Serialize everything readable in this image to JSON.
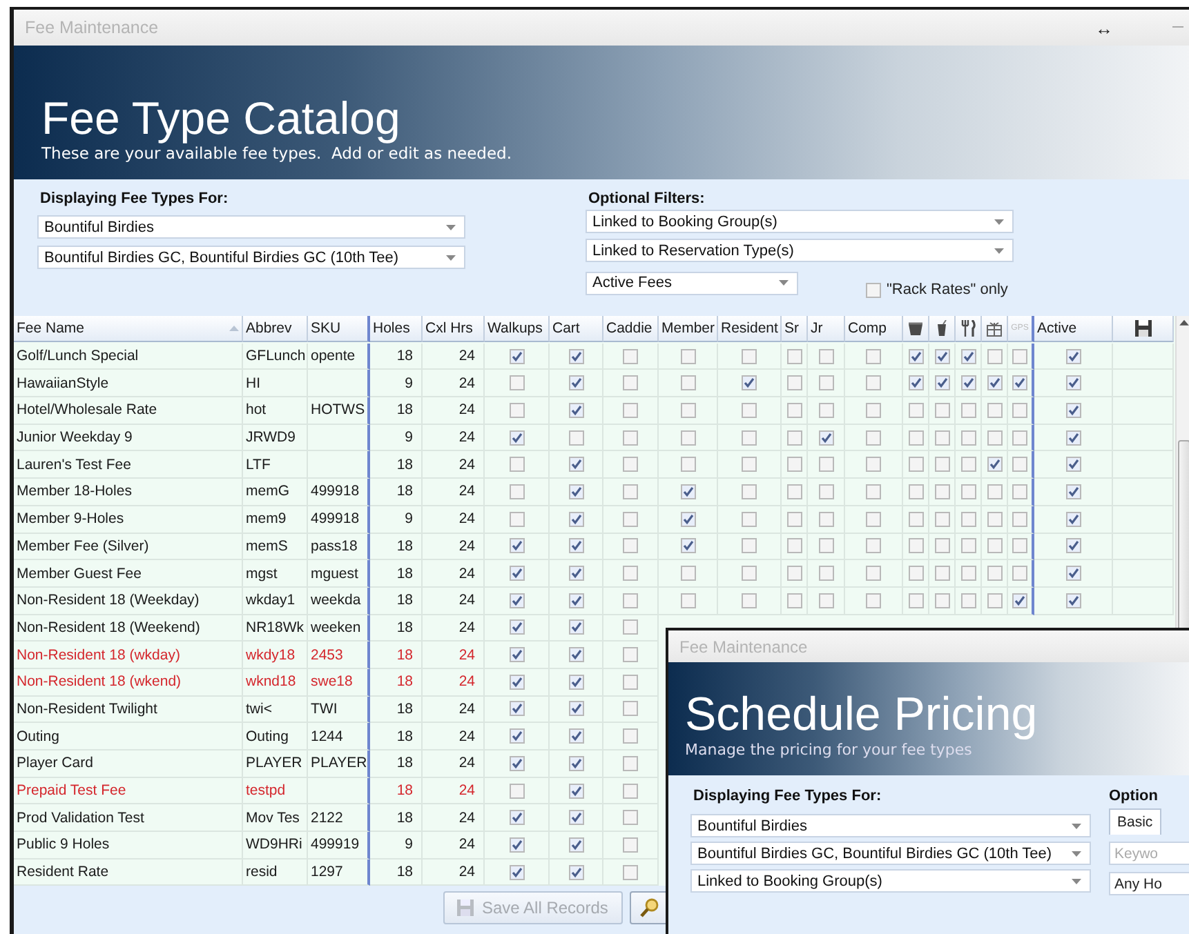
{
  "window": {
    "title": "Fee Maintenance",
    "resize_glyph": "↔"
  },
  "header": {
    "title": "Fee Type Catalog",
    "subtitle": "These are your available fee types.  Add or edit as needed."
  },
  "filters": {
    "label": "Displaying Fee Types For:",
    "dropdowns": [
      "Bountiful Birdies",
      "Bountiful Birdies GC, Bountiful Birdies GC (10th Tee)"
    ],
    "optional_label": "Optional Filters:",
    "optional_dropdowns": [
      "Linked to Booking Group(s)",
      "Linked to Reservation Type(s)",
      "Active Fees"
    ],
    "rack_rates": {
      "label": "\"Rack Rates\" only",
      "checked": false
    }
  },
  "table": {
    "columns": [
      {
        "label": "Fee Name",
        "sorted": true
      },
      {
        "label": "Abbrev",
        "sorted": false
      },
      {
        "label": "SKU",
        "sorted": false
      },
      {
        "label": "Holes",
        "sorted": false
      },
      {
        "label": "Cxl Hrs",
        "sorted": false
      }
    ],
    "check_columns": [
      {
        "kind": "text",
        "label": "Walkups"
      },
      {
        "kind": "text",
        "label": "Cart"
      },
      {
        "kind": "text",
        "label": "Caddie"
      },
      {
        "kind": "text",
        "label": "Member"
      },
      {
        "kind": "text",
        "label": "Resident"
      },
      {
        "kind": "text",
        "label": "Sr"
      },
      {
        "kind": "text",
        "label": "Jr"
      },
      {
        "kind": "text",
        "label": "Comp"
      },
      {
        "kind": "icon"
      },
      {
        "kind": "icon"
      },
      {
        "kind": "icon"
      },
      {
        "kind": "icon"
      },
      {
        "kind": "tag",
        "label": "GPS"
      },
      {
        "kind": "text",
        "label": "Active"
      }
    ],
    "rows": [
      {
        "name": "Golf/Lunch Special",
        "abbrev": "GFLunch",
        "sku": "opente",
        "holes": "18",
        "cxl_hrs": "24",
        "flagged": false,
        "checks": [
          true,
          true,
          false,
          false,
          false,
          false,
          false,
          false,
          true,
          true,
          true,
          false,
          false,
          true
        ]
      },
      {
        "name": "HawaiianStyle",
        "abbrev": "HI",
        "holes": "9",
        "cxl_hrs": "24",
        "flagged": false,
        "checks": [
          false,
          true,
          false,
          false,
          true,
          false,
          false,
          false,
          true,
          true,
          true,
          true,
          true,
          true
        ]
      },
      {
        "name": "Hotel/Wholesale Rate",
        "abbrev": "hot",
        "sku": "HOTWS",
        "holes": "18",
        "cxl_hrs": "24",
        "flagged": false,
        "checks": [
          false,
          true,
          false,
          false,
          false,
          false,
          false,
          false,
          false,
          false,
          false,
          false,
          false,
          true
        ]
      },
      {
        "name": "Junior Weekday 9",
        "abbrev": "JRWD9",
        "holes": "9",
        "cxl_hrs": "24",
        "flagged": false,
        "checks": [
          true,
          false,
          false,
          false,
          false,
          false,
          true,
          false,
          false,
          false,
          false,
          false,
          false,
          true
        ]
      },
      {
        "name": "Lauren's Test Fee",
        "abbrev": "LTF",
        "holes": "18",
        "cxl_hrs": "24",
        "flagged": false,
        "checks": [
          false,
          true,
          false,
          false,
          false,
          false,
          false,
          false,
          false,
          false,
          false,
          true,
          false,
          true
        ]
      },
      {
        "name": "Member 18-Holes",
        "abbrev": "memG",
        "sku": "499918",
        "holes": "18",
        "cxl_hrs": "24",
        "flagged": false,
        "checks": [
          false,
          true,
          false,
          true,
          false,
          false,
          false,
          false,
          false,
          false,
          false,
          false,
          false,
          true
        ]
      },
      {
        "name": "Member 9-Holes",
        "abbrev": "mem9",
        "sku": "499918",
        "holes": "9",
        "cxl_hrs": "24",
        "flagged": false,
        "checks": [
          false,
          true,
          false,
          true,
          false,
          false,
          false,
          false,
          false,
          false,
          false,
          false,
          false,
          true
        ]
      },
      {
        "name": "Member Fee (Silver)",
        "abbrev": "memS",
        "sku": "pass18",
        "holes": "18",
        "cxl_hrs": "24",
        "flagged": false,
        "checks": [
          true,
          true,
          false,
          true,
          false,
          false,
          false,
          false,
          false,
          false,
          false,
          false,
          false,
          true
        ]
      },
      {
        "name": "Member Guest Fee",
        "abbrev": "mgst",
        "sku": "mguest",
        "holes": "18",
        "cxl_hrs": "24",
        "flagged": false,
        "checks": [
          true,
          true,
          false,
          false,
          false,
          false,
          false,
          false,
          false,
          false,
          false,
          false,
          false,
          true
        ]
      },
      {
        "name": "Non-Resident 18 (Weekday)",
        "abbrev": "wkday1",
        "sku": "weekda",
        "holes": "18",
        "cxl_hrs": "24",
        "flagged": false,
        "checks": [
          true,
          true,
          false,
          false,
          false,
          false,
          false,
          false,
          false,
          false,
          false,
          false,
          true,
          true
        ]
      },
      {
        "name": "Non-Resident 18 (Weekend)",
        "abbrev": "NR18Wk",
        "sku": "weeken",
        "holes": "18",
        "cxl_hrs": "24",
        "flagged": false,
        "checks": [
          true,
          true,
          false
        ]
      },
      {
        "name": "Non-Resident 18 (wkday)",
        "abbrev": "wkdy18",
        "sku": "2453",
        "holes": "18",
        "cxl_hrs": "24",
        "flagged": true,
        "checks": [
          true,
          true,
          false
        ]
      },
      {
        "name": "Non-Resident 18 (wkend)",
        "abbrev": "wknd18",
        "sku": "swe18",
        "holes": "18",
        "cxl_hrs": "24",
        "flagged": true,
        "checks": [
          true,
          true,
          false
        ]
      },
      {
        "name": "Non-Resident Twilight",
        "abbrev": "twi<",
        "sku": "TWI",
        "holes": "18",
        "cxl_hrs": "24",
        "flagged": false,
        "checks": [
          true,
          true,
          false
        ]
      },
      {
        "name": "Outing",
        "abbrev": "Outing",
        "sku": "1244",
        "holes": "18",
        "cxl_hrs": "24",
        "flagged": false,
        "checks": [
          true,
          true,
          false
        ]
      },
      {
        "name": "Player Card",
        "abbrev": "PLAYER",
        "sku": "PLAYER",
        "holes": "18",
        "cxl_hrs": "24",
        "flagged": false,
        "checks": [
          true,
          true,
          false
        ]
      },
      {
        "name": "Prepaid Test Fee",
        "abbrev": "testpd",
        "holes": "18",
        "cxl_hrs": "24",
        "flagged": true,
        "checks": [
          false,
          true,
          false
        ]
      },
      {
        "name": "Prod Validation Test",
        "abbrev": "Mov Tes",
        "sku": "2122",
        "holes": "18",
        "cxl_hrs": "24",
        "flagged": false,
        "checks": [
          true,
          true,
          false
        ]
      },
      {
        "name": "Public 9 Holes",
        "abbrev": "WD9HRi",
        "sku": "499919",
        "holes": "9",
        "cxl_hrs": "24",
        "flagged": false,
        "checks": [
          true,
          true,
          false
        ]
      },
      {
        "name": "Resident Rate",
        "abbrev": "resid",
        "sku": "1297",
        "holes": "18",
        "cxl_hrs": "24",
        "flagged": false,
        "checks": [
          true,
          true,
          false
        ]
      }
    ]
  },
  "footer": {
    "save_button": {
      "label": "Save All Records",
      "disabled": true
    }
  },
  "overlay": {
    "title": "Fee Maintenance",
    "header": {
      "title": "Schedule Pricing",
      "subtitle": "Manage the pricing for your fee types"
    },
    "label": "Displaying Fee Types For:",
    "dropdowns": [
      "Bountiful Birdies",
      "Bountiful Birdies GC, Bountiful Birdies GC (10th Tee)",
      "Linked to Booking Group(s)"
    ],
    "optional_label": "Option",
    "tabs": [
      {
        "label": "Basic",
        "selected": true
      }
    ],
    "keyword": {
      "placeholder": "Keywo"
    },
    "holes_value": "Any Ho"
  }
}
